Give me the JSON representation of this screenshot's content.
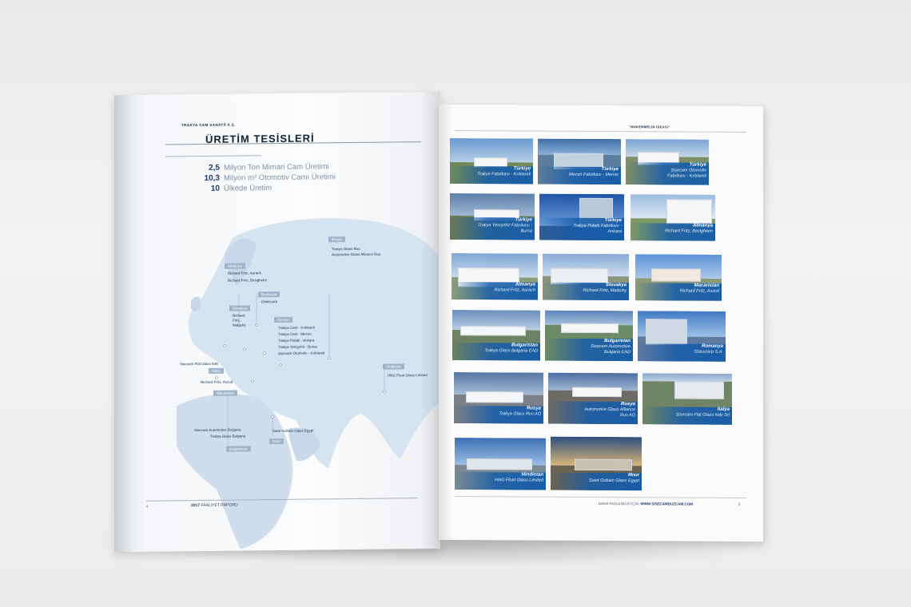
{
  "left_page": {
    "company": "TRAKYA CAM SANAYİİ A.Ş.",
    "title": "ÜRETİM TESİSLERİ",
    "stats": [
      {
        "value": "2,5",
        "text": "Milyon Ton Mimari Cam Üretimi"
      },
      {
        "value": "10,3",
        "text": "Milyon m² Otomotiv Camı Üretimi"
      },
      {
        "value": "10",
        "text": "Ülkede Üretim"
      }
    ],
    "map": {
      "tags": {
        "rusya": "Rusya",
        "almanya": "Almanya",
        "romanya": "Romanya",
        "slovakya": "Slovakya",
        "turkiye": "Türkiye",
        "italya": "İtalya",
        "macaristan": "Macaristan",
        "hindistan": "Hindistan",
        "misir": "Mısır",
        "bulgaristan": "Bulgaristan"
      },
      "labels": {
        "rusya_1": "Trakya Glass Rus",
        "rusya_2": "Automotive Glass Alliance Rus",
        "almanya_1": "Richard Fritz, Aurach",
        "almanya_2": "Richard Fritz, Besigheim",
        "romanya_1": "Glasscorp",
        "slovakya_1": "Richard",
        "slovakya_2": "Fritz,",
        "slovakya_3": "Malacky",
        "turkiye_1": "Trakya Cam - Kırklareli",
        "turkiye_2": "Trakya Cam - Mersin",
        "turkiye_3": "Trakya Polatlı - Ankara",
        "turkiye_4": "Trakya Yenişehir - Bursa",
        "turkiye_5": "Şişecam Otomotiv - Kırklareli",
        "italya_1": "Sisecam Flat Glass Italy",
        "macaristan_1": "Richard Fritz, Aszod",
        "hindistan_1": "HNG Float Glass Limited",
        "bulgaristan_1": "Sisecam Automotive Bulgaria",
        "bulgaristan_2": "Trakya Glass Bulgaria",
        "misir_1": "Saint Gobain Glass Egypt"
      }
    },
    "footer": {
      "year": "2017",
      "label": "FAALİYET RAPORU",
      "page": "4"
    }
  },
  "right_page": {
    "header": "\"MÜKEMMELİN İDEASI\"",
    "photos": [
      {
        "country": "Türkiye",
        "plant": "Trakya Fabrikası - Kırklareli"
      },
      {
        "country": "Türkiye",
        "plant": "Mersin Fabrikası - Mersin"
      },
      {
        "country": "Türkiye",
        "plant": "Şişecam Otomotiv",
        "plant2": "Fabrikası - Kırklareli"
      },
      {
        "country": "Türkiye",
        "plant": "Trakya Yenişehir Fabrikası -",
        "plant2": "Bursa"
      },
      {
        "country": "Türkiye",
        "plant": "Trakya Polatlı Fabrikası -",
        "plant2": "Ankara"
      },
      {
        "country": "Almanya",
        "plant": "Richard Fritz, Besigheim"
      },
      {
        "country": "Almanya",
        "plant": "Richard Fritz, Aurach"
      },
      {
        "country": "Slovakya",
        "plant": "Richard Fritz, Malacky"
      },
      {
        "country": "Macaristan",
        "plant": "Richard Fritz, Aszod"
      },
      {
        "country": "Bulgaristan",
        "plant": "Trakya Glass Bulgaria EAD"
      },
      {
        "country": "Bulgaristan",
        "plant": "Sisecam Automotive",
        "plant2": "Bulgaria EAD"
      },
      {
        "country": "Romanya",
        "plant": "Glasscorp S.A."
      },
      {
        "country": "Rusya",
        "plant": "Trakya Glass Rus AO"
      },
      {
        "country": "Rusya",
        "plant": "Automotive Glass Alliance",
        "plant2": "Rus AO"
      },
      {
        "country": "İtalya",
        "plant": "Sisecam Flat Glass Italy Srl"
      },
      {
        "country": "Hindistan",
        "plant": "HNG Float Glass Limited"
      },
      {
        "country": "Mısır",
        "plant": "Saint Gobain Glass Egypt"
      }
    ],
    "footer": {
      "text": "DAHA FAZLA BİLGİ İÇİN:",
      "url": "WWW.SISECAMDUZCAM.COM",
      "page": "5"
    }
  }
}
